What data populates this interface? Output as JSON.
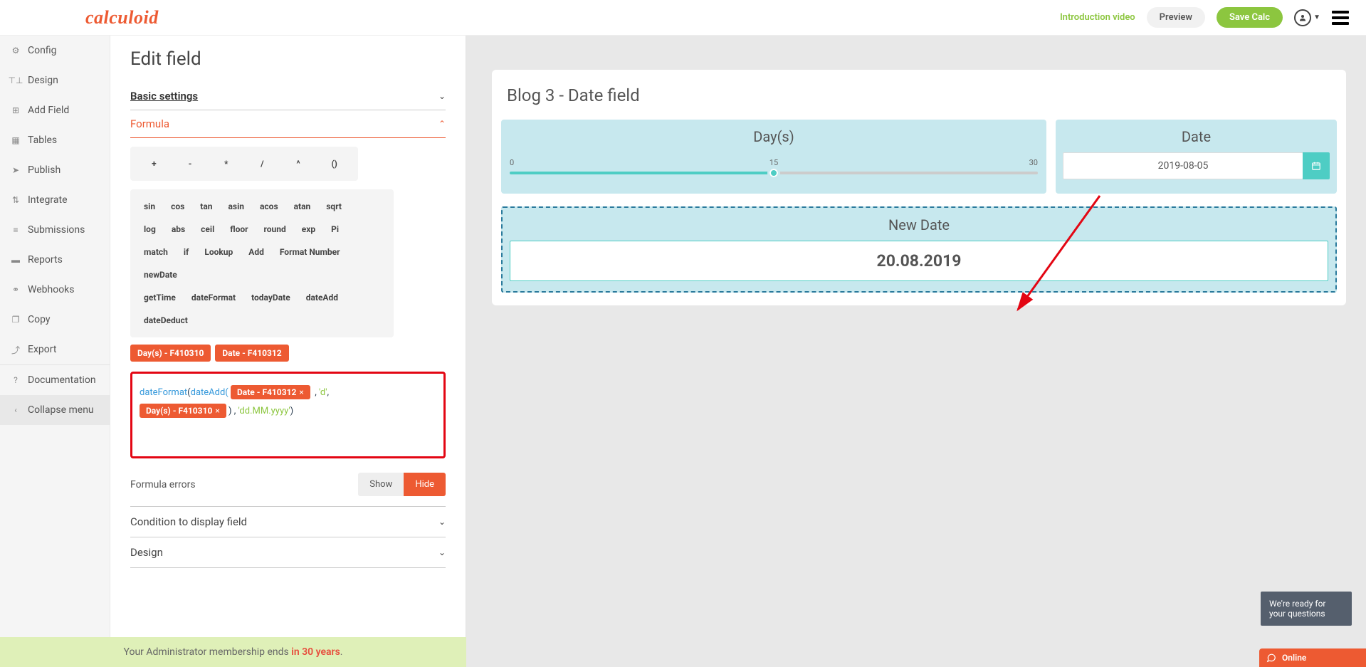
{
  "header": {
    "logo": "calculoid",
    "intro_link": "Introduction video",
    "preview": "Preview",
    "save": "Save Calc"
  },
  "sidebar": {
    "items": [
      {
        "label": "Config",
        "icon": "⚙"
      },
      {
        "label": "Design",
        "icon": "⊤⊥"
      },
      {
        "label": "Add Field",
        "icon": "⊞"
      },
      {
        "label": "Tables",
        "icon": "▦"
      },
      {
        "label": "Publish",
        "icon": "➤"
      },
      {
        "label": "Integrate",
        "icon": "⇅"
      },
      {
        "label": "Submissions",
        "icon": "≡"
      },
      {
        "label": "Reports",
        "icon": "▬"
      },
      {
        "label": "Webhooks",
        "icon": "⚭"
      },
      {
        "label": "Copy",
        "icon": "❐"
      },
      {
        "label": "Export",
        "icon": "⤴"
      },
      {
        "label": "Documentation",
        "icon": "?"
      },
      {
        "label": "Collapse menu",
        "icon": "‹"
      }
    ]
  },
  "panel": {
    "title": "Edit field",
    "sections": {
      "basic": "Basic settings",
      "formula": "Formula",
      "condition": "Condition to display field",
      "design": "Design"
    },
    "ops": {
      "row1": [
        "+",
        "-",
        "*",
        "/",
        "^",
        "()"
      ],
      "row2": [
        "sin",
        "cos",
        "tan",
        "asin",
        "acos",
        "atan",
        "sqrt"
      ],
      "row3": [
        "log",
        "abs",
        "ceil",
        "floor",
        "round",
        "exp",
        "Pi"
      ],
      "row4": [
        "match",
        "if",
        "Lookup",
        "Add",
        "Format Number",
        "newDate"
      ],
      "row5": [
        "getTime",
        "dateFormat",
        "todayDate",
        "dateAdd",
        "dateDeduct"
      ]
    },
    "tags": [
      "Day(s) - F410310",
      "Date - F410312"
    ],
    "formula": {
      "fn1": "dateFormat",
      "fn2": "dateAdd(",
      "chip1": "Date - F410312",
      "arg_d": ", 'd',",
      "chip2": "Day(s) - F410310",
      "close1": " ) ,",
      "fmt": " 'dd.MM.yyyy'",
      "close2": ")"
    },
    "errors": {
      "label": "Formula errors",
      "show": "Show",
      "hide": "Hide"
    }
  },
  "membership": {
    "text1": "Your Administrator membership ends ",
    "text2": "in 30 years",
    "dot": "."
  },
  "calc": {
    "title": "Blog 3 - Date field",
    "days": {
      "label": "Day(s)",
      "min": "0",
      "mid": "15",
      "max": "30"
    },
    "date": {
      "label": "Date",
      "value": "2019-08-05"
    },
    "newdate": {
      "label": "New Date",
      "value": "20.08.2019"
    }
  },
  "chat": {
    "tooltip": "We're ready for your questions",
    "label": "Online"
  }
}
